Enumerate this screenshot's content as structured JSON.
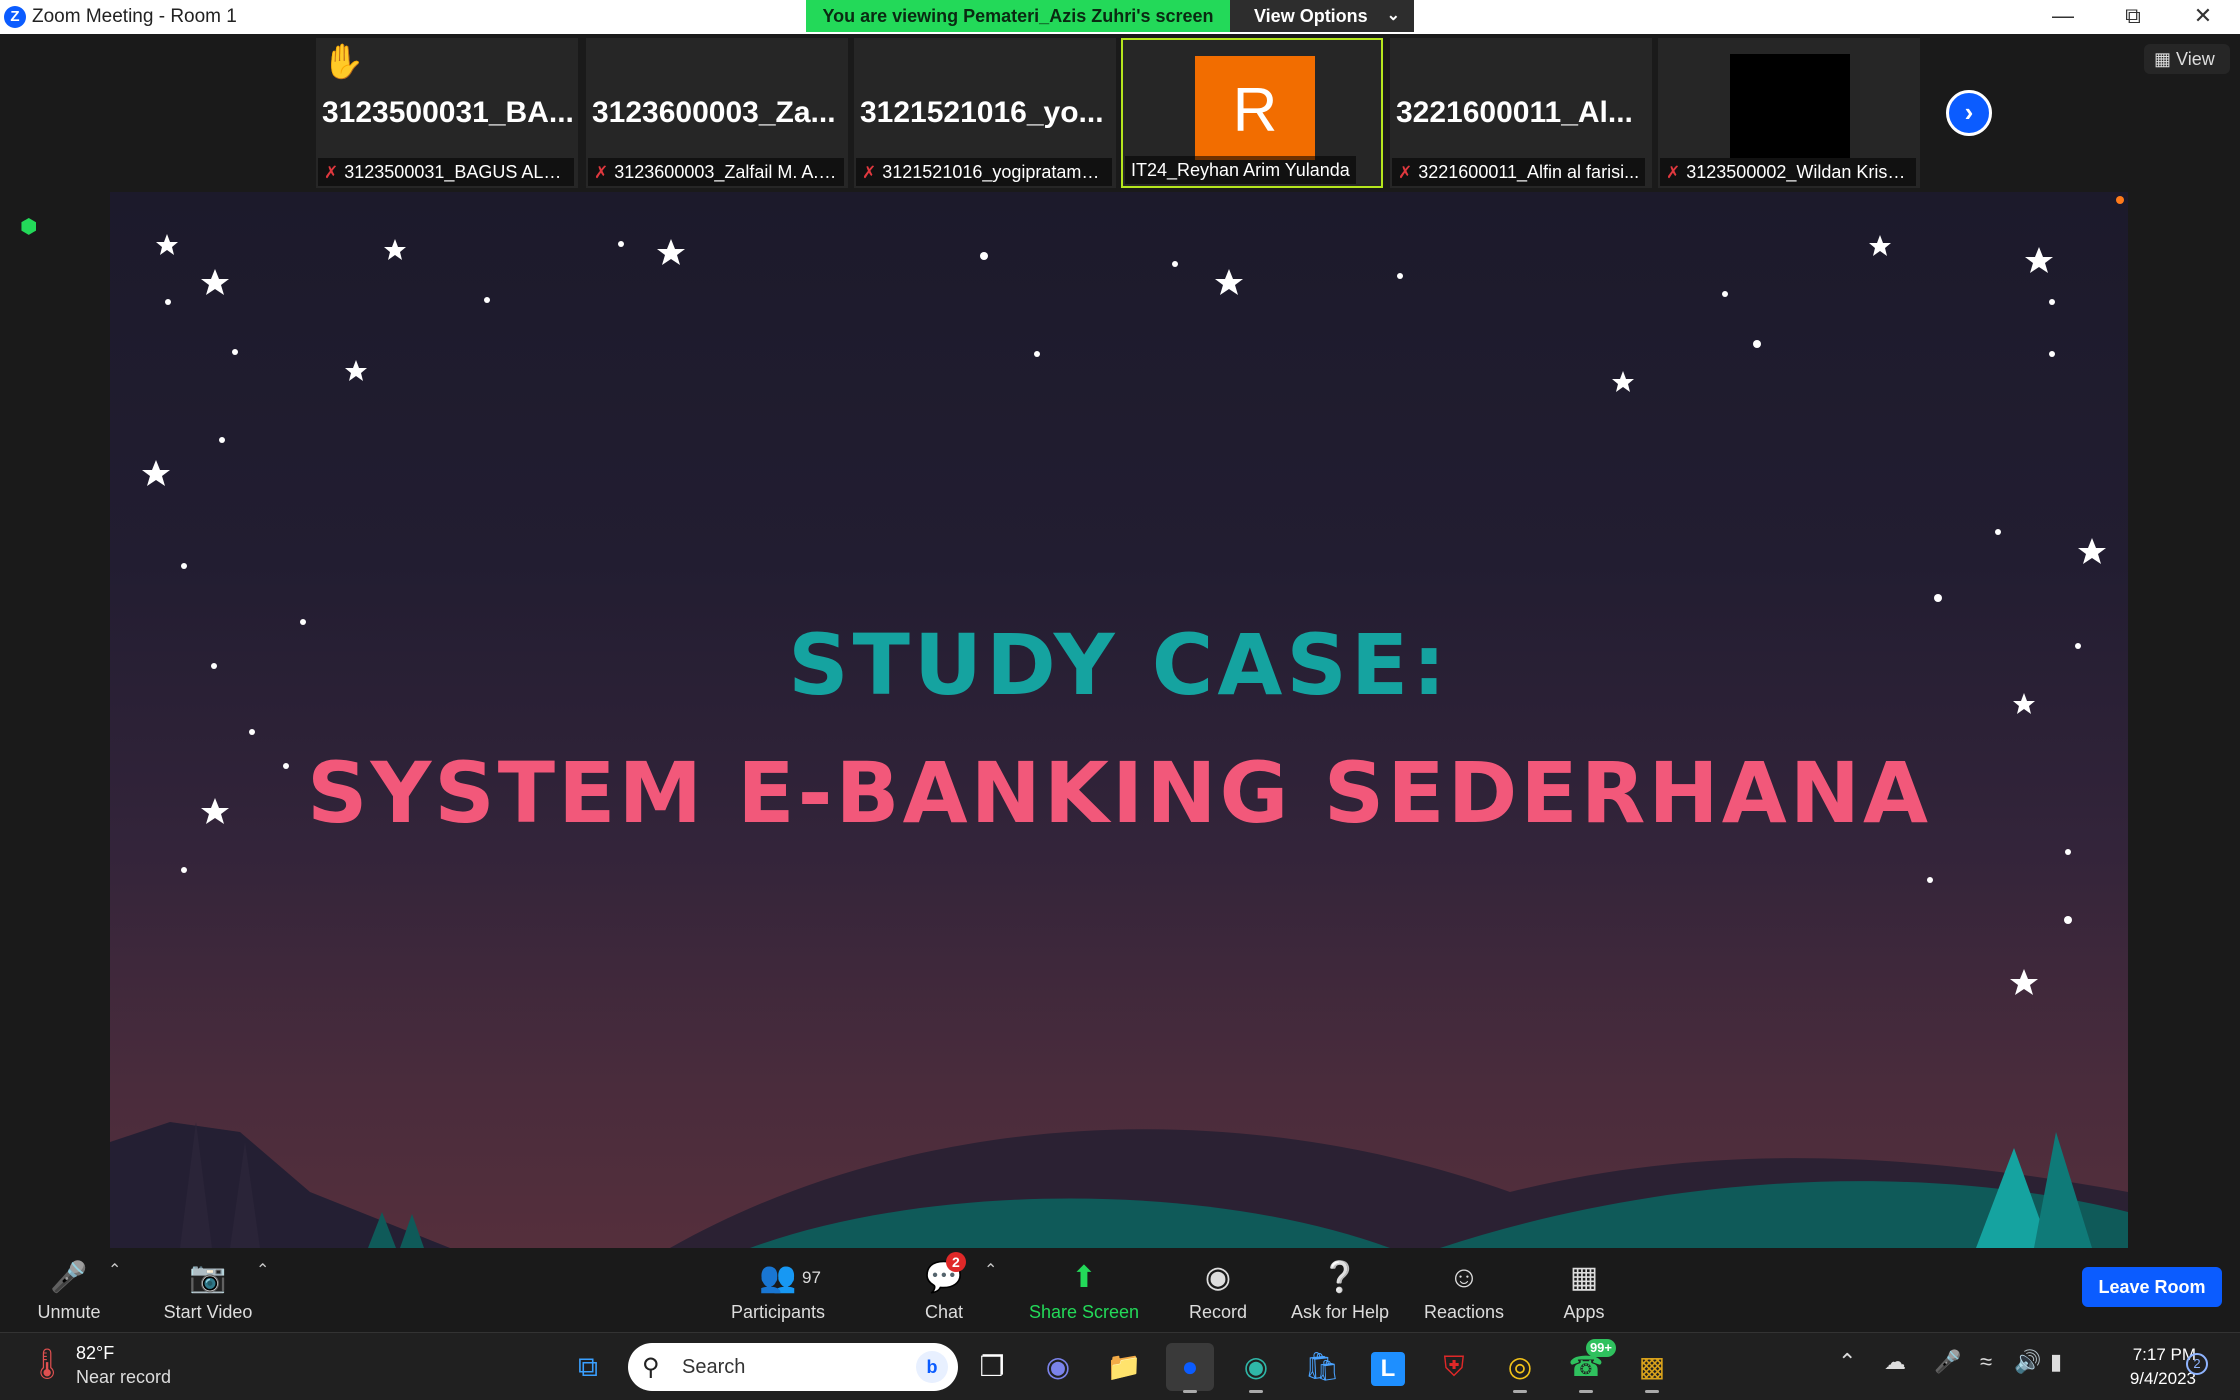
{
  "window": {
    "title": "Zoom Meeting - Room 1",
    "banner": "You are viewing Pemateri_Azis Zuhri's screen",
    "view_options": "View Options",
    "view_label": "View"
  },
  "participants_strip": [
    {
      "big_name": "3123500031_BA...",
      "label": "3123500031_BAGUS ALFI...",
      "muted": true,
      "hand_raised": true
    },
    {
      "big_name": "3123600003_Za...",
      "label": "3123600003_Zalfail M. A._1",
      "muted": true
    },
    {
      "big_name": "3121521016_yo...",
      "label": "3121521016_yogipratama...",
      "muted": true
    },
    {
      "avatar_letter": "R",
      "label": "IT24_Reyhan Arim Yulanda",
      "muted": false,
      "active_speaker": true
    },
    {
      "big_name": "3221600011_Al...",
      "label": "3221600011_Alfin al farisi...",
      "muted": true
    },
    {
      "label": "3123500002_Wildan Krisn...",
      "muted": true,
      "video_black": true
    }
  ],
  "shared_screen": {
    "line1": "STUDY CASE:",
    "line2": "SYSTEM E-BANKING SEDERHANA",
    "colors": {
      "line1": "#15a3a0",
      "line2": "#f2587a"
    }
  },
  "toolbar": {
    "unmute": "Unmute",
    "start_video": "Start Video",
    "participants": "Participants",
    "participants_count": "97",
    "chat": "Chat",
    "chat_badge": "2",
    "share_screen": "Share Screen",
    "record": "Record",
    "ask_for_help": "Ask for Help",
    "reactions": "Reactions",
    "apps": "Apps",
    "leave_room": "Leave Room"
  },
  "taskbar": {
    "weather_temp": "82°F",
    "weather_desc": "Near record",
    "search_placeholder": "Search",
    "whatsapp_badge": "99+",
    "time": "7:17 PM",
    "date": "9/4/2023",
    "notification_count": "2"
  },
  "colors": {
    "zoom_blue": "#0b5cff",
    "banner_green": "#23d959",
    "active_border": "#b5e61d",
    "avatar_orange": "#f26d00"
  }
}
